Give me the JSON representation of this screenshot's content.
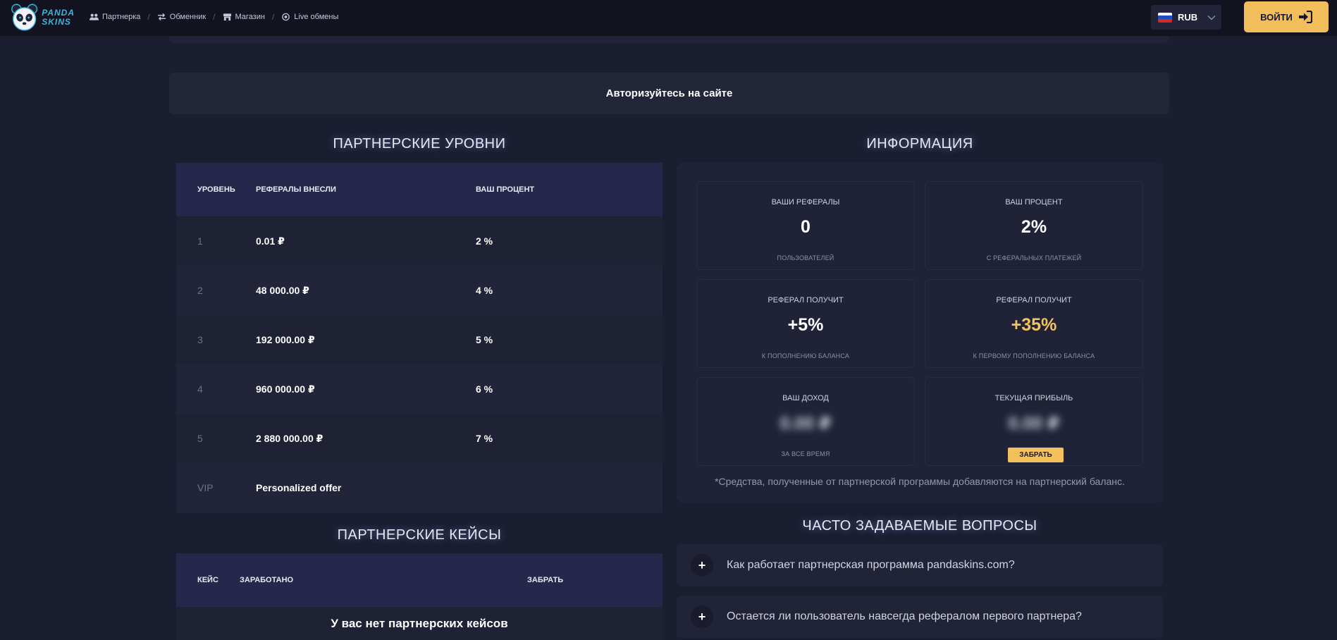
{
  "header": {
    "logo_line1": "PANDA",
    "logo_line2": "SKINS",
    "nav": [
      {
        "label": "Партнерка",
        "icon": "users-icon"
      },
      {
        "label": "Обменник",
        "icon": "exchange-icon"
      },
      {
        "label": "Магазин",
        "icon": "store-icon"
      },
      {
        "label": "Live обмены",
        "icon": "live-icon"
      }
    ],
    "currency": {
      "code": "RUB",
      "flag": "russia-flag-icon"
    },
    "login_label": "ВОЙТИ"
  },
  "auth_banner": "Авторизуйтесь на сайте",
  "levels": {
    "title": "ПАРТНЕРСКИЕ УРОВНИ",
    "columns": [
      "УРОВЕНЬ",
      "РЕФЕРАЛЫ ВНЕСЛИ",
      "ВАШ ПРОЦЕНТ"
    ],
    "rows": [
      {
        "level": "1",
        "deposited": "0.01 ₽",
        "percent": "2 %"
      },
      {
        "level": "2",
        "deposited": "48 000.00 ₽",
        "percent": "4 %"
      },
      {
        "level": "3",
        "deposited": "192 000.00 ₽",
        "percent": "5 %"
      },
      {
        "level": "4",
        "deposited": "960 000.00 ₽",
        "percent": "6 %"
      },
      {
        "level": "5",
        "deposited": "2 880 000.00 ₽",
        "percent": "7 %"
      },
      {
        "level": "VIP",
        "deposited": "Personalized offer",
        "percent": ""
      }
    ]
  },
  "cases": {
    "title": "ПАРТНЕРСКИЕ КЕЙСЫ",
    "columns": [
      "КЕЙС",
      "ЗАРАБОТАНО",
      "ЗАБРАТЬ"
    ],
    "empty": "У вас нет партнерских кейсов"
  },
  "info": {
    "title": "ИНФОРМАЦИЯ",
    "cards": [
      {
        "label": "ВАШИ РЕФЕРАЛЫ",
        "value": "0",
        "sub": "ПОЛЬЗОВАТЕЛЕЙ"
      },
      {
        "label": "ВАШ ПРОЦЕНТ",
        "value": "2%",
        "sub": "С РЕФЕРАЛЬНЫХ ПЛАТЕЖЕЙ"
      },
      {
        "label": "РЕФЕРАЛ ПОЛУЧИТ",
        "value": "+5%",
        "sub": "К ПОПОЛНЕНИЮ БАЛАНСА"
      },
      {
        "label": "РЕФЕРАЛ ПОЛУЧИТ",
        "value": "+35%",
        "sub": "К ПЕРВОМУ ПОПОЛНЕНИЮ БАЛАНСА"
      },
      {
        "label": "ВАШ ДОХОД",
        "value": "0.00 ₽",
        "sub": "ЗА ВСЕ ВРЕМЯ"
      },
      {
        "label": "ТЕКУЩАЯ ПРИБЫЛЬ",
        "value": "0.00 ₽",
        "sub": ""
      }
    ],
    "claim_label": "ЗАБРАТЬ",
    "note": "*Средства, полученные от партнерской программы добавляются на партнерский баланс."
  },
  "faq": {
    "title": "ЧАСТО ЗАДАВАЕМЫЕ ВОПРОСЫ",
    "items": [
      {
        "question": "Как работает партнерская программа pandaskins.com?"
      },
      {
        "question": "Остается ли пользователь навсегда рефералом первого партнера?"
      }
    ]
  },
  "colors": {
    "background": "#1b1d31",
    "header": "#12131f",
    "panel": "#202338",
    "accent_gold": "#f2bd5b",
    "logo_blue": "#3fb5e0"
  }
}
